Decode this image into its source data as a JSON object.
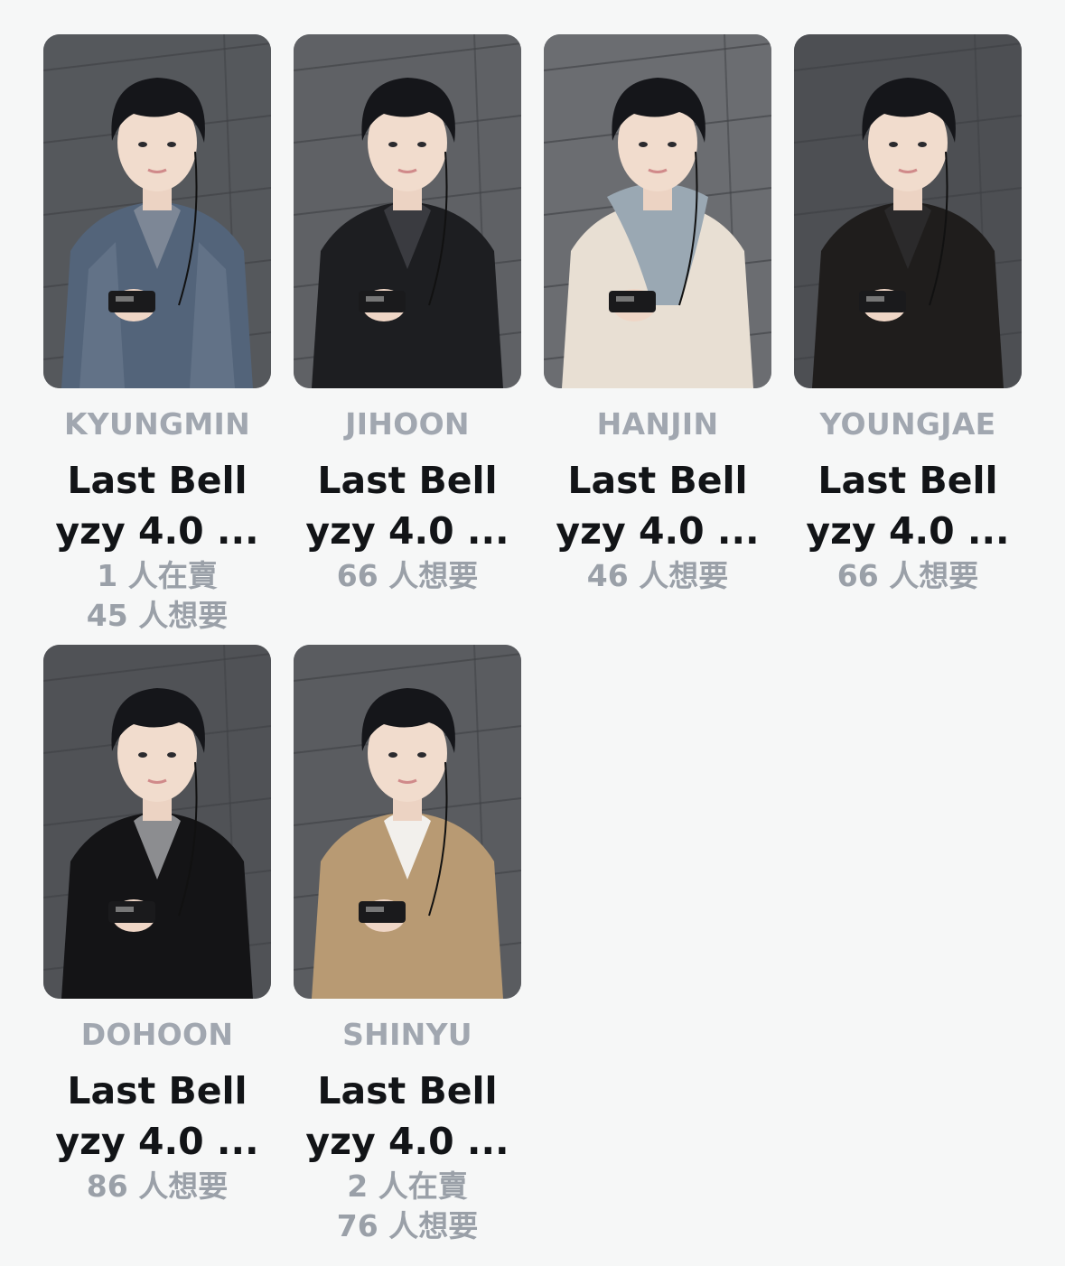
{
  "cards": [
    {
      "member": "KYUNGMIN",
      "title_line1": "Last Bell",
      "title_line2": "yzy 4.0 ...",
      "stats": [
        "1 人在賣",
        "45 人想要"
      ],
      "outfit": "denim",
      "jacket": "#53647a",
      "inner": "#7d8796",
      "bg": "#55585c"
    },
    {
      "member": "JIHOON",
      "title_line1": "Last Bell",
      "title_line2": "yzy 4.0 ...",
      "stats": [
        "66 人想要"
      ],
      "outfit": "black-jacket",
      "jacket": "#1d1e21",
      "inner": "#3a3b40",
      "bg": "#5f6165"
    },
    {
      "member": "HANJIN",
      "title_line1": "Last Bell",
      "title_line2": "yzy 4.0 ...",
      "stats": [
        "46 人想要"
      ],
      "outfit": "scarf",
      "jacket": "#e8dfd3",
      "inner": "#9aa8b3",
      "bg": "#6b6d71"
    },
    {
      "member": "YOUNGJAE",
      "title_line1": "Last Bell",
      "title_line2": "yzy 4.0 ...",
      "stats": [
        "66 人想要"
      ],
      "outfit": "black-jacket",
      "jacket": "#1f1d1c",
      "inner": "#2b2a2b",
      "bg": "#4d4f53"
    },
    {
      "member": "DOHOON",
      "title_line1": "Last Bell",
      "title_line2": "yzy 4.0 ...",
      "stats": [
        "86 人想要"
      ],
      "outfit": "leather",
      "jacket": "#141416",
      "inner": "#8c8d90",
      "bg": "#505256"
    },
    {
      "member": "SHINYU",
      "title_line1": "Last Bell",
      "title_line2": "yzy 4.0 ...",
      "stats": [
        "2 人在賣",
        "76 人想要"
      ],
      "outfit": "tan-jacket",
      "jacket": "#b89a73",
      "inner": "#f2f0ec",
      "bg": "#5a5c60"
    }
  ]
}
